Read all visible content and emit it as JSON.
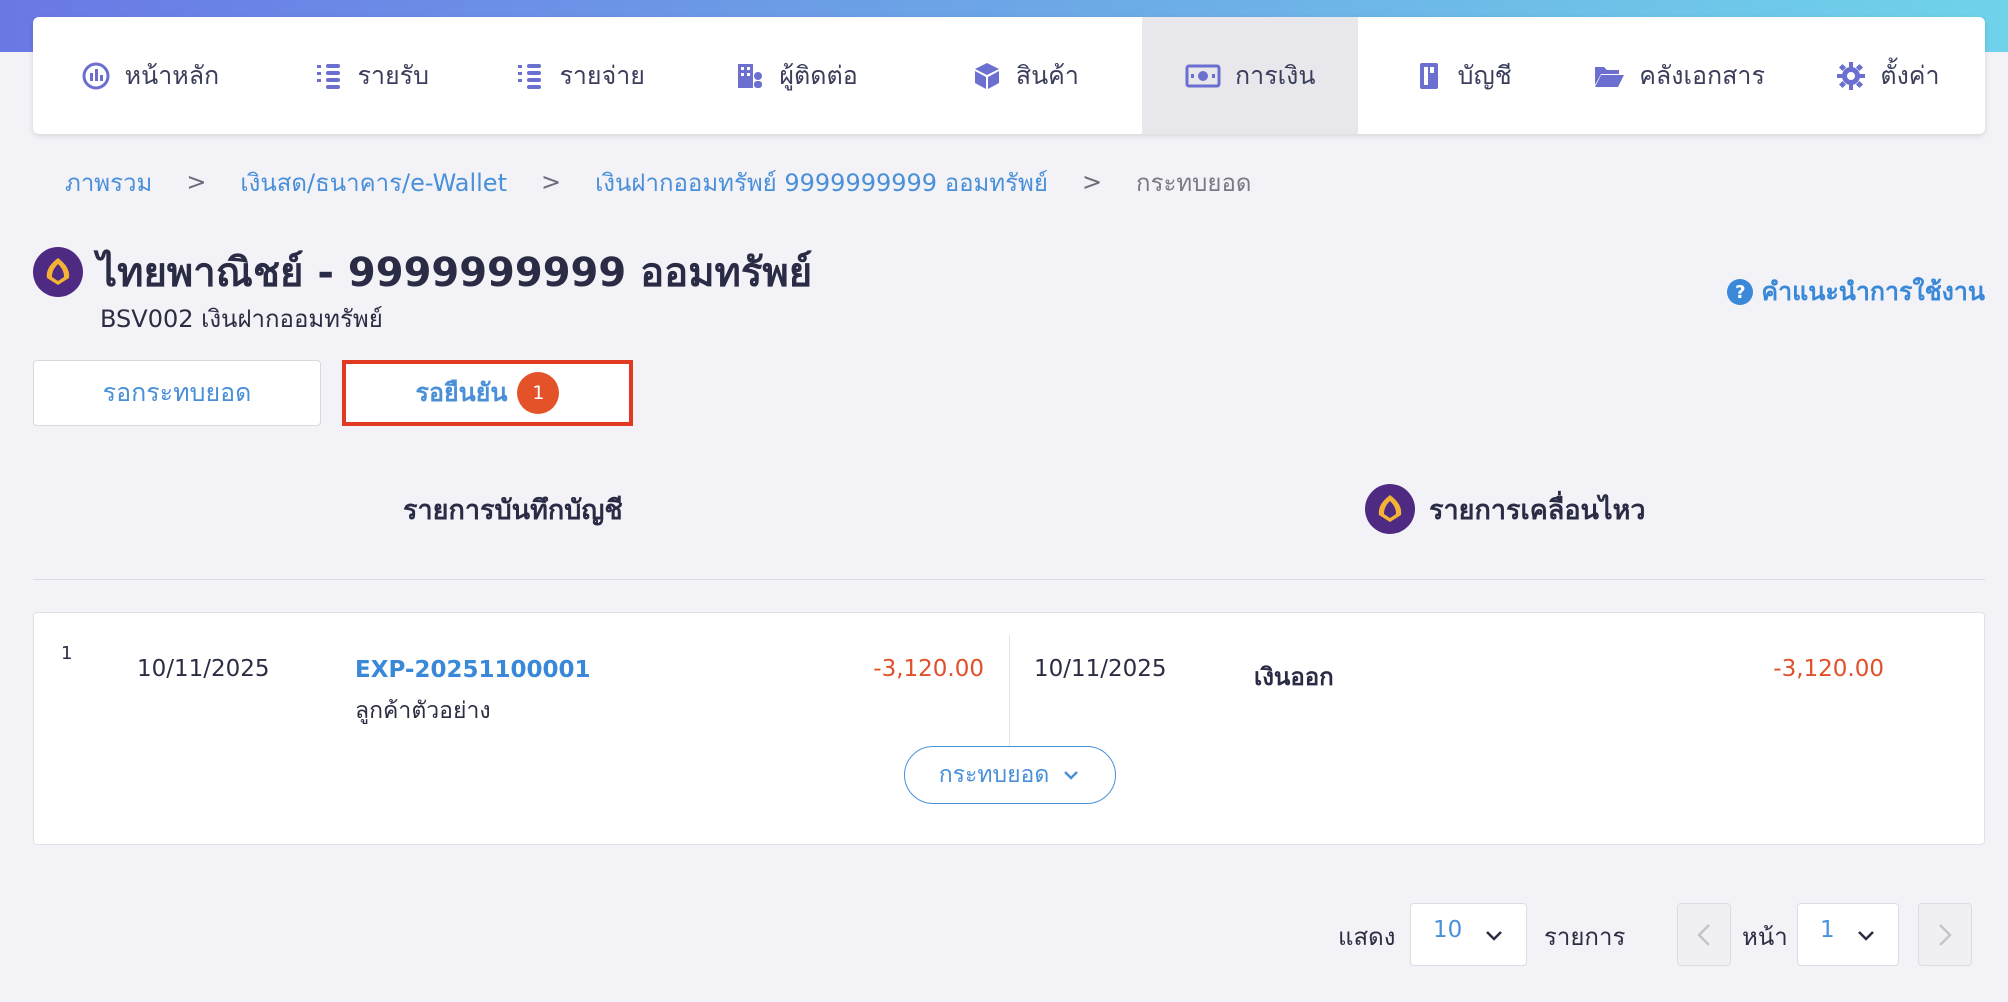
{
  "nav": {
    "items": [
      {
        "label": "หน้าหลัก",
        "icon": "dashboard-icon"
      },
      {
        "label": "รายรับ",
        "icon": "coins-stack-icon"
      },
      {
        "label": "รายจ่าย",
        "icon": "coins-stack-icon"
      },
      {
        "label": "ผู้ติดต่อ",
        "icon": "building-user-icon"
      },
      {
        "label": "สินค้า",
        "icon": "box-icon"
      },
      {
        "label": "การเงิน",
        "icon": "money-bill-icon",
        "active": true
      },
      {
        "label": "บัญชี",
        "icon": "ledger-book-icon"
      },
      {
        "label": "คลังเอกสาร",
        "icon": "folder-open-icon"
      },
      {
        "label": "ตั้งค่า",
        "icon": "gear-icon"
      }
    ]
  },
  "breadcrumb": {
    "items": [
      "ภาพรวม",
      "เงินสด/ธนาคาร/e-Wallet",
      "เงินฝากออมทรัพย์ 9999999999 ออมทรัพย์"
    ],
    "separator": ">",
    "current": "กระทบยอด"
  },
  "account": {
    "title": "ไทยพาณิชย์ - 9999999999 ออมทรัพย์",
    "subtitle": "BSV002 เงินฝากออมทรัพย์",
    "bank_color": "#4e2a82",
    "bank_logo_color": "#f5b335"
  },
  "help": {
    "label": "คำแนะนำการใช้งาน",
    "icon": "question-circle-icon"
  },
  "tabs": [
    {
      "label": "รอกระทบยอด"
    },
    {
      "label": "รอยืนยัน",
      "badge": "1",
      "active": true
    }
  ],
  "columns": {
    "left": "รายการบันทึกบัญชี",
    "right": "รายการเคลื่อนไหว"
  },
  "rows": [
    {
      "num": "1",
      "book_date": "10/11/2025",
      "doc_no": "EXP-20251100001",
      "contact": "ลูกค้าตัวอย่าง",
      "book_amount": "-3,120.00",
      "mov_date": "10/11/2025",
      "mov_type": "เงินออก",
      "mov_amount": "-3,120.00",
      "action_label": "กระทบยอด"
    }
  ],
  "pagination": {
    "show_label": "แสดง",
    "page_size": "10",
    "items_label": "รายการ",
    "page_label": "หน้า",
    "page": "1"
  },
  "colors": {
    "accent": "#4a90d9",
    "negative": "#e0502a",
    "badge": "#e4522a",
    "highlight_border": "#e23a22"
  }
}
